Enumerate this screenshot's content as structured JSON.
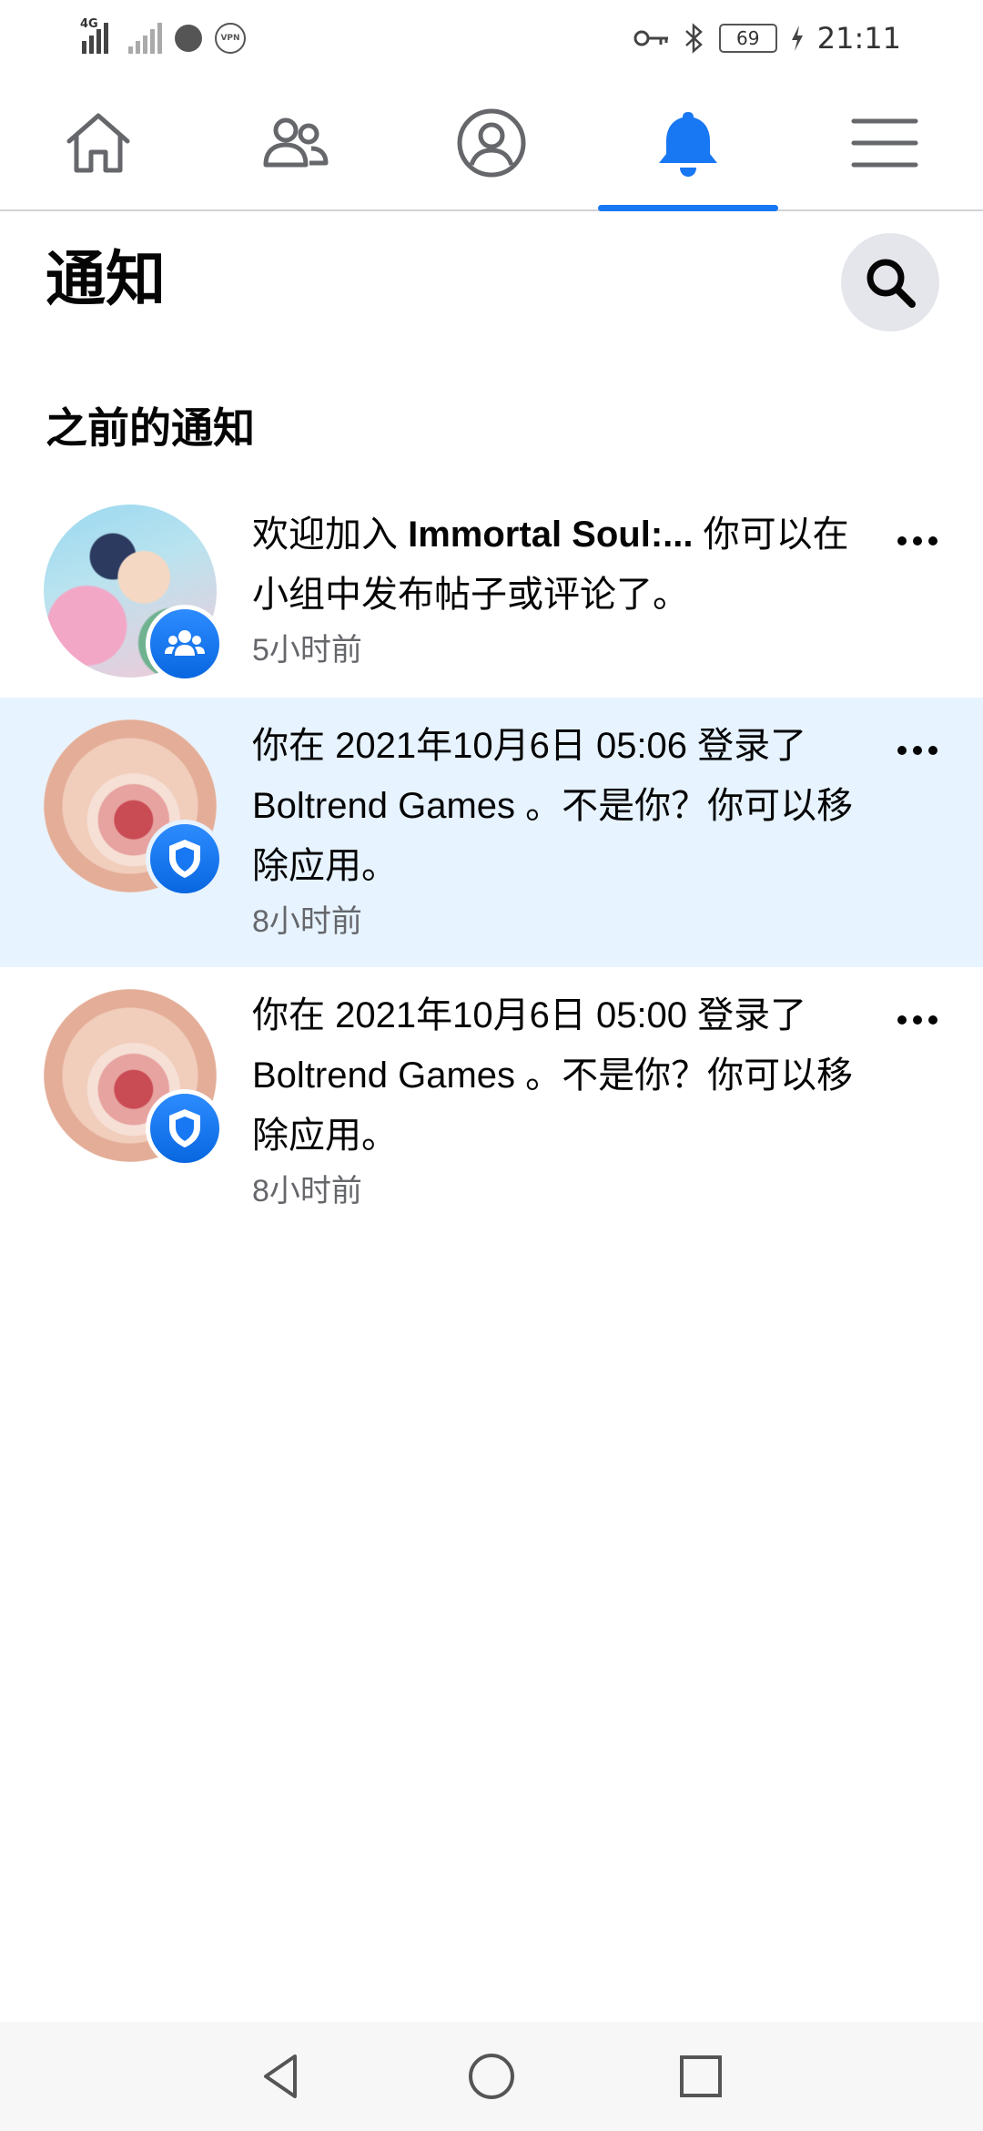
{
  "status_bar": {
    "network_tag": "4G",
    "vpn_label": "VPN",
    "battery_level": "69",
    "time": "21:11"
  },
  "top_nav": {
    "tabs": [
      {
        "icon": "home-icon",
        "active": false
      },
      {
        "icon": "friends-icon",
        "active": false
      },
      {
        "icon": "profile-icon",
        "active": false
      },
      {
        "icon": "bell-icon",
        "active": true
      },
      {
        "icon": "menu-icon",
        "active": false
      }
    ],
    "accent_color": "#1877f2"
  },
  "header": {
    "title": "通知",
    "search_icon": "search-icon"
  },
  "section": {
    "title": "之前的通知"
  },
  "notifications": [
    {
      "text_before": "欢迎加入 ",
      "text_bold": "Immortal Soul:...",
      "text_after": " 你可以在小组中发布帖子或评论了。",
      "time": "5小时前",
      "badge_icon": "group-icon",
      "unread": false
    },
    {
      "text": "你在 2021年10月6日 05:06 登录了 Boltrend Games 。不是你？你可以移除应用。",
      "time": "8小时前",
      "badge_icon": "shield-icon",
      "unread": true
    },
    {
      "text": "你在 2021年10月6日 05:00 登录了 Boltrend Games 。不是你？你可以移除应用。",
      "time": "8小时前",
      "badge_icon": "shield-icon",
      "unread": false
    }
  ],
  "colors": {
    "unread_background": "#e7f3ff",
    "badge_blue": "#1877f2",
    "secondary_text": "#65676b"
  }
}
